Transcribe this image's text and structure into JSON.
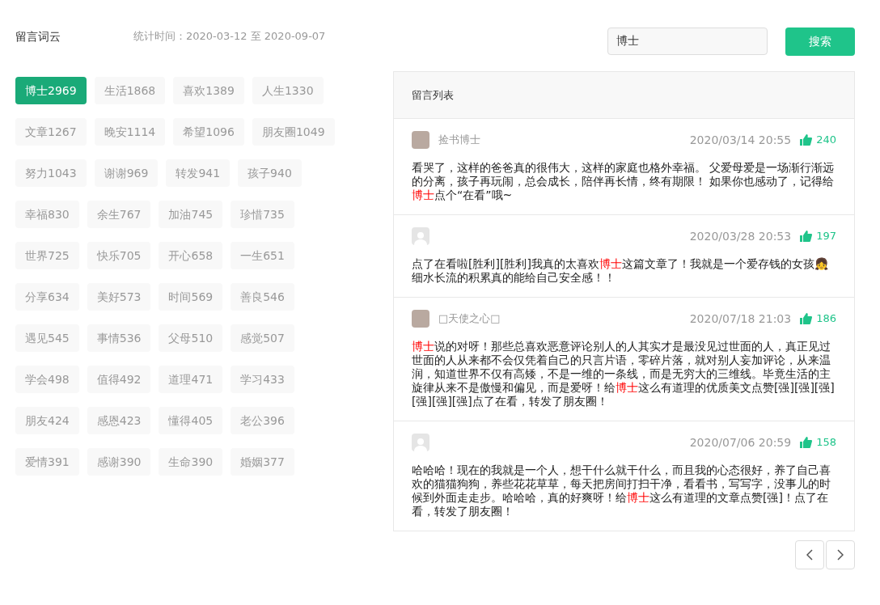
{
  "title": "留言词云",
  "stat_period": "统计时间：2020-03-12 至 2020-09-07",
  "search": {
    "value": "博士",
    "button": "搜索"
  },
  "tags": [
    {
      "label": "博士2969",
      "selected": true
    },
    {
      "label": "生活1868",
      "selected": false
    },
    {
      "label": "喜欢1389",
      "selected": false
    },
    {
      "label": "人生1330",
      "selected": false
    },
    {
      "label": "文章1267",
      "selected": false
    },
    {
      "label": "晚安1114",
      "selected": false
    },
    {
      "label": "希望1096",
      "selected": false
    },
    {
      "label": "朋友圈1049",
      "selected": false
    },
    {
      "label": "努力1043",
      "selected": false
    },
    {
      "label": "谢谢969",
      "selected": false
    },
    {
      "label": "转发941",
      "selected": false
    },
    {
      "label": "孩子940",
      "selected": false
    },
    {
      "label": "幸福830",
      "selected": false
    },
    {
      "label": "余生767",
      "selected": false
    },
    {
      "label": "加油745",
      "selected": false
    },
    {
      "label": "珍惜735",
      "selected": false
    },
    {
      "label": "世界725",
      "selected": false
    },
    {
      "label": "快乐705",
      "selected": false
    },
    {
      "label": "开心658",
      "selected": false
    },
    {
      "label": "一生651",
      "selected": false
    },
    {
      "label": "分享634",
      "selected": false
    },
    {
      "label": "美好573",
      "selected": false
    },
    {
      "label": "时间569",
      "selected": false
    },
    {
      "label": "善良546",
      "selected": false
    },
    {
      "label": "遇见545",
      "selected": false
    },
    {
      "label": "事情536",
      "selected": false
    },
    {
      "label": "父母510",
      "selected": false
    },
    {
      "label": "感觉507",
      "selected": false
    },
    {
      "label": "学会498",
      "selected": false
    },
    {
      "label": "值得492",
      "selected": false
    },
    {
      "label": "道理471",
      "selected": false
    },
    {
      "label": "学习433",
      "selected": false
    },
    {
      "label": "朋友424",
      "selected": false
    },
    {
      "label": "感恩423",
      "selected": false
    },
    {
      "label": "懂得405",
      "selected": false
    },
    {
      "label": "老公396",
      "selected": false
    },
    {
      "label": "爱情391",
      "selected": false
    },
    {
      "label": "感谢390",
      "selected": false
    },
    {
      "label": "生命390",
      "selected": false
    },
    {
      "label": "婚姻377",
      "selected": false
    }
  ],
  "comments_panel": {
    "title": "留言列表",
    "comments": [
      {
        "kind": "photo-avatar",
        "user": "捡书博士",
        "time": "2020/03/14 20:55",
        "likes": "240",
        "text": [
          {
            "t": "看哭了，这样的爸爸真的很伟大，这样的家庭也格外幸福。 父爱母爱是一场渐行渐远的分离，孩子再玩闹，总会成长，陪伴再长情，终有期限！ 如果你也感动了，记得给",
            "highlight": false
          },
          {
            "t": "博士",
            "highlight": true
          },
          {
            "t": "点个“在看”哦~",
            "highlight": false
          }
        ]
      },
      {
        "kind": "default-avatar",
        "time": "2020/03/28 20:53",
        "likes": "197",
        "text": [
          {
            "t": "点了在看啦[胜利][胜利]我真的太喜欢",
            "highlight": false
          },
          {
            "t": "博士",
            "highlight": true
          },
          {
            "t": "这篇文章了！我就是一个爱存钱的女孩👧 细水长流的积累真的能给自己安全感！！",
            "highlight": false
          }
        ]
      },
      {
        "kind": "photo-avatar",
        "user": "□天使之心□",
        "time": "2020/07/18 21:03",
        "likes": "186",
        "text": [
          {
            "t": "博士",
            "highlight": true
          },
          {
            "t": "说的对呀！那些总喜欢恶意评论别人的人其实才是最没见过世面的人，真正见过世面的人从来都不会仅凭着自己的只言片语，零碎片落，就对别人妄加评论，从来温润，知道世界不仅有高矮，不是一维的一条线，而是无穷大的三维线。毕竟生活的主旋律从来不是傲慢和偏见，而是爱呀！给",
            "highlight": false
          },
          {
            "t": "博士",
            "highlight": true
          },
          {
            "t": "这么有道理的优质美文点赞[强][强][强][强][强][强]点了在看，转发了朋友圈！",
            "highlight": false
          }
        ]
      },
      {
        "kind": "default-avatar",
        "time": "2020/07/06 20:59",
        "likes": "158",
        "text": [
          {
            "t": "哈哈哈！现在的我就是一个人，想干什么就干什么，而且我的心态很好，养了自己喜欢的猫猫狗狗，养些花花草草，每天把房间打扫干净，看看书，写写字，没事儿的时候到外面走走步。哈哈哈，真的好爽呀！给",
            "highlight": false
          },
          {
            "t": "博士",
            "highlight": true
          },
          {
            "t": "这么有道理的文章点赞[强]！点了在看，转发了朋友圈！",
            "highlight": false
          }
        ]
      }
    ]
  }
}
